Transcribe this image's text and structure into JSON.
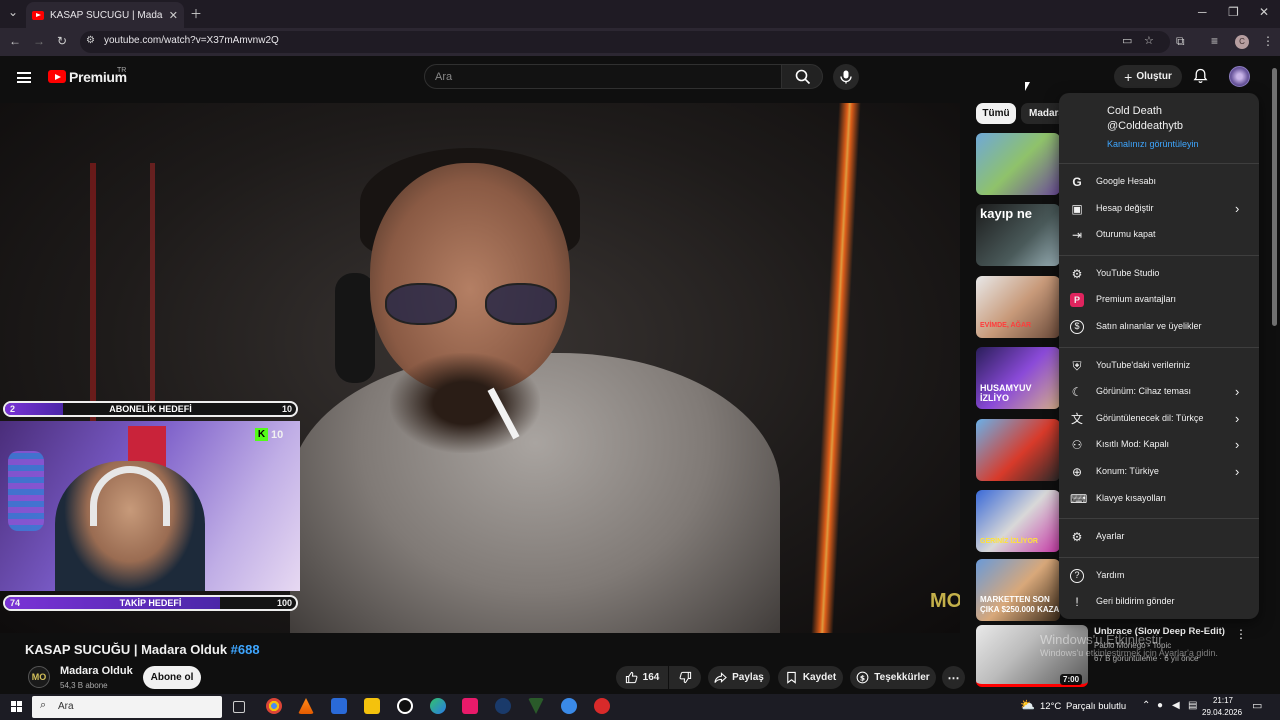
{
  "browser": {
    "tab_title": "KASAP SUCUĞU | Madara O",
    "url": "youtube.com/watch?v=X37mAmvnw2Q",
    "profile_initial": "C"
  },
  "header": {
    "brand": "Premium",
    "region": "TR",
    "search_placeholder": "Ara",
    "create_label": "Oluştur"
  },
  "video": {
    "title": "KASAP SUCUĞU | Madara Olduk",
    "episode_tag": "#688",
    "watermark": "MO",
    "overlay": {
      "sub_goal": {
        "label": "ABONELİK HEDEFİ",
        "current": "2",
        "target": "10",
        "progress": 0.2
      },
      "follow_goal": {
        "label": "TAKİP HEDEFİ",
        "current": "74",
        "target": "100",
        "progress": 0.74
      },
      "kick_count": "10",
      "kick_letter": "K"
    }
  },
  "channel": {
    "avatar_text": "MO",
    "name": "Madara Olduk",
    "subscribers": "54,3 B abone",
    "subscribe_label": "Abone ol"
  },
  "actions": {
    "likes": "164",
    "share": "Paylaş",
    "save": "Kaydet",
    "thanks": "Teşekkürler"
  },
  "sidebar": {
    "chips": [
      "Tümü",
      "Madara"
    ],
    "thumbs": [
      {
        "caption": ""
      },
      {
        "caption": "kayıp ne"
      },
      {
        "caption": "EVİMDE, AĞAR"
      },
      {
        "caption": "HUSAMYUV İZLİYO"
      },
      {
        "caption": ""
      },
      {
        "caption": "GERİNİZ İZLİYOR"
      },
      {
        "caption": "MARKETTEN SON ÇIKA $250.000 KAZA"
      }
    ],
    "rec": {
      "title": "Unbrace (Slow Deep Re-Edit)",
      "artist": "Pablo Moriego - Topic",
      "meta": "67 B görüntüleme · 6 yıl önce",
      "duration": "7:00"
    },
    "windows_notice_1": "Windows'u Etkinleştir",
    "windows_notice_2": "Windows'u etkinleştirmek için Ayarlar'a gidin."
  },
  "account_menu": {
    "name": "Cold Death",
    "handle": "@Colddeathytb",
    "view_channel": "Kanalınızı görüntüleyin",
    "groups": [
      [
        {
          "icon": "google-icon",
          "label": "Google Hesabı",
          "chevron": false
        },
        {
          "icon": "switch-account-icon",
          "label": "Hesap değiştir",
          "chevron": true
        },
        {
          "icon": "sign-out-icon",
          "label": "Oturumu kapat",
          "chevron": false
        }
      ],
      [
        {
          "icon": "youtube-studio-icon",
          "label": "YouTube Studio",
          "chevron": false
        },
        {
          "icon": "premium-icon",
          "label": "Premium avantajları",
          "chevron": false
        },
        {
          "icon": "dollar-icon",
          "label": "Satın alınanlar ve üyelikler",
          "chevron": false
        }
      ],
      [
        {
          "icon": "shield-person-icon",
          "label": "YouTube'daki verileriniz",
          "chevron": false
        },
        {
          "icon": "moon-icon",
          "label": "Görünüm: Cihaz teması",
          "chevron": true
        },
        {
          "icon": "translate-icon",
          "label": "Görüntülenecek dil: Türkçe",
          "chevron": true
        },
        {
          "icon": "restricted-mode-icon",
          "label": "Kısıtlı Mod: Kapalı",
          "chevron": true
        },
        {
          "icon": "globe-icon",
          "label": "Konum: Türkiye",
          "chevron": true
        },
        {
          "icon": "keyboard-icon",
          "label": "Klavye kısayolları",
          "chevron": false
        }
      ],
      [
        {
          "icon": "gear-icon",
          "label": "Ayarlar",
          "chevron": false
        }
      ],
      [
        {
          "icon": "help-icon",
          "label": "Yardım",
          "chevron": false
        },
        {
          "icon": "feedback-icon",
          "label": "Geri bildirim gönder",
          "chevron": false
        }
      ]
    ]
  },
  "taskbar": {
    "search_label": "Ara",
    "temperature": "12°C",
    "weather": "Parçalı bulutlu",
    "time": "21:17",
    "date": "29.04.2026"
  },
  "colors": {
    "youtube_red": "#ff0000",
    "link_blue": "#3ea6ff",
    "goal_purple": "#7a33d6",
    "kick_green": "#53fc18"
  }
}
